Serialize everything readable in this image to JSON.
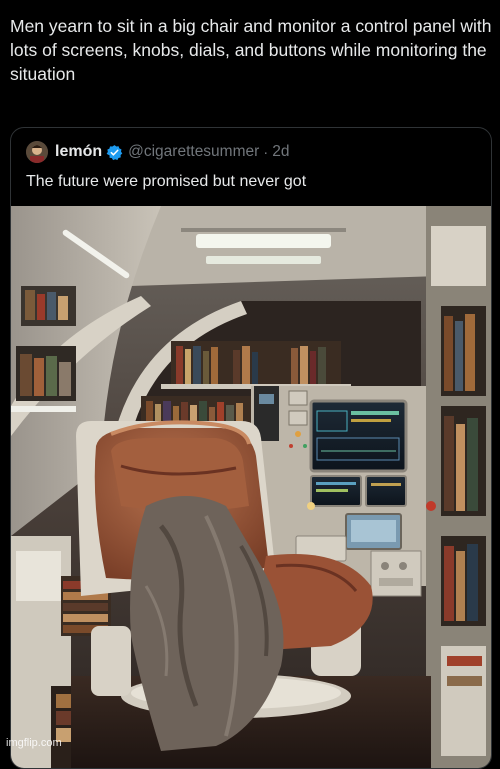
{
  "caption": "Men yearn to sit in a big chair and monitor a control panel with lots of screens, knobs, dials, and buttons while monitoring the situation",
  "quoted_post": {
    "author_name": "lemón",
    "handle": "@cigarettesummer",
    "separator": "·",
    "time": "2d",
    "text": "The future were promised but never got",
    "verified": true
  },
  "colors": {
    "background": "#000000",
    "text": "#e7e9ea",
    "muted": "#71767b",
    "border": "#2f3336",
    "verified_badge": "#1d9bf0"
  },
  "photo": {
    "icon": "sci-fi-cockpit-photo"
  },
  "watermark": "imgflip.com"
}
